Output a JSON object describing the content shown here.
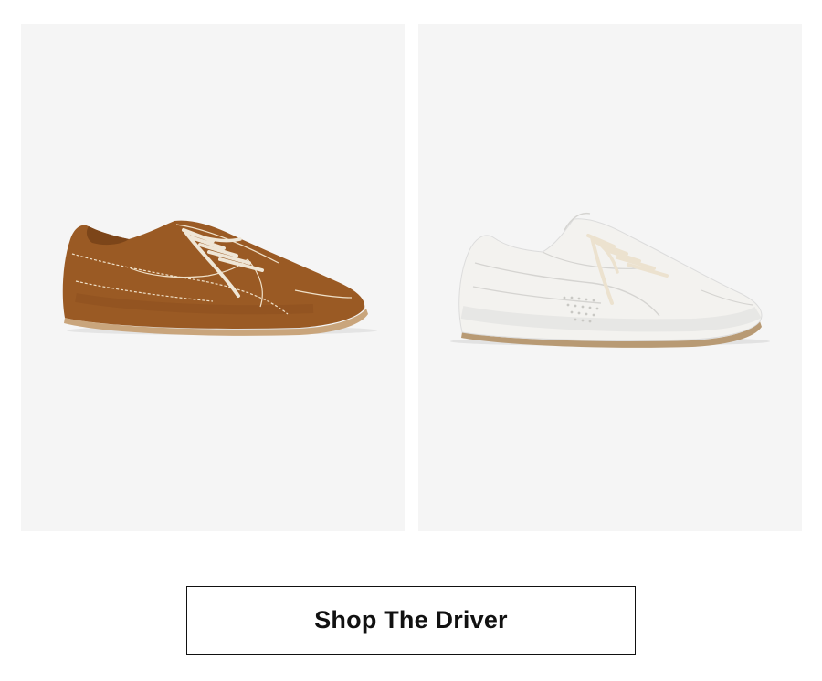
{
  "products": [
    {
      "name": "suede-driver-sneaker",
      "image_icon": "brown-suede-sneaker-icon",
      "upper_color": "#9a5a24",
      "sole_color": "#c9a57c",
      "lace_color": "#efe6d6"
    },
    {
      "name": "leather-driver-sneaker",
      "image_icon": "white-leather-sneaker-icon",
      "upper_color": "#f3f2ef",
      "sole_color": "#b89a74",
      "lace_color": "#ece2cf"
    }
  ],
  "cta": {
    "label": "Shop The Driver"
  },
  "colors": {
    "tile_background": "#f5f5f5",
    "button_border": "#111111",
    "text": "#111111"
  }
}
